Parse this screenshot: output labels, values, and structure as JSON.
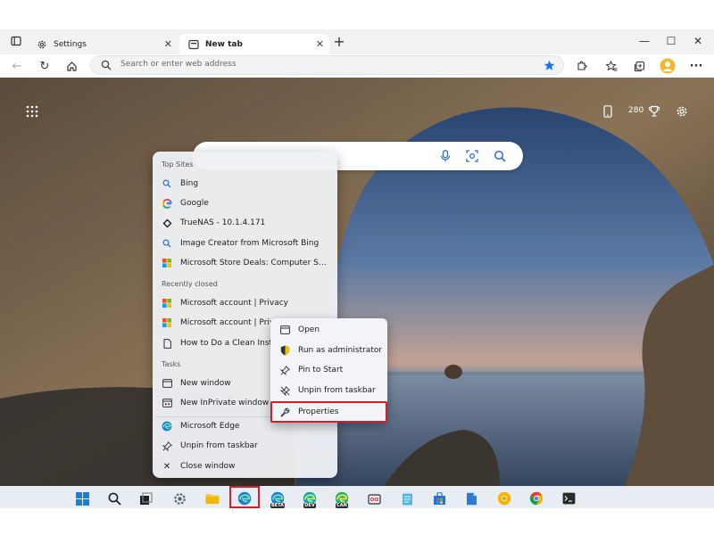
{
  "browser": {
    "tabs": [
      {
        "label": "Settings",
        "icon": "gear-icon"
      },
      {
        "label": "New tab",
        "icon": "newtab-icon"
      }
    ],
    "address_placeholder": "Search or enter web address"
  },
  "ntp": {
    "rewards_points": "280"
  },
  "jumplist": {
    "sections": {
      "top_sites": "Top Sites",
      "recently_closed": "Recently closed",
      "tasks": "Tasks"
    },
    "top_sites": [
      {
        "label": "Bing",
        "icon": "search-icon"
      },
      {
        "label": "Google",
        "icon": "google-icon"
      },
      {
        "label": "TrueNAS - 10.1.4.171",
        "icon": "truenas-icon"
      },
      {
        "label": "Image Creator from Microsoft Bing",
        "icon": "search-icon"
      },
      {
        "label": "Microsoft Store Deals: Computer Sal...",
        "icon": "microsoft-icon"
      }
    ],
    "recently_closed": [
      {
        "label": "Microsoft account | Privacy",
        "icon": "microsoft-icon"
      },
      {
        "label": "Microsoft account | Priv",
        "icon": "microsoft-icon"
      },
      {
        "label": "How to Do a Clean Insta",
        "icon": "document-icon"
      }
    ],
    "tasks": [
      {
        "label": "New window",
        "icon": "window-icon"
      },
      {
        "label": "New InPrivate window",
        "icon": "inprivate-icon"
      }
    ],
    "app_items": [
      {
        "label": "Microsoft Edge",
        "icon": "edge-icon"
      },
      {
        "label": "Unpin from taskbar",
        "icon": "unpin-icon"
      },
      {
        "label": "Close window",
        "icon": "close-icon"
      }
    ]
  },
  "context_menu": {
    "items": [
      {
        "label": "Open",
        "icon": "open-icon"
      },
      {
        "label": "Run as administrator",
        "icon": "shield-icon"
      },
      {
        "label": "Pin to Start",
        "icon": "pin-icon"
      },
      {
        "label": "Unpin from taskbar",
        "icon": "unpin-icon"
      },
      {
        "label": "Properties",
        "icon": "wrench-icon"
      }
    ]
  },
  "taskbar": {
    "badges": [
      "BETA",
      "DEV",
      "CAN"
    ]
  },
  "colors": {
    "highlight": "#d91c2a",
    "edge_blue": "#1a7fd4",
    "accent_star": "#1a73e8"
  }
}
